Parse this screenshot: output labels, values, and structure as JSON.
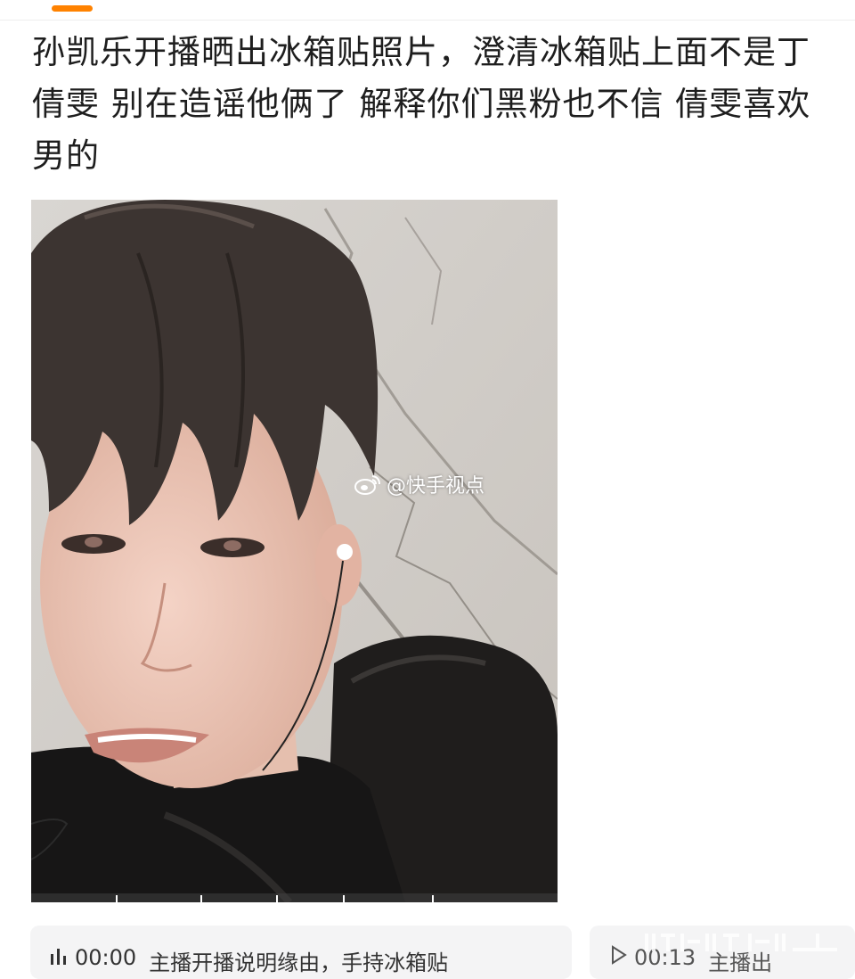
{
  "nav": {
    "active_tab_color": "#ff8200"
  },
  "post": {
    "text": "孙凯乐开播晒出冰箱贴照片，澄清冰箱贴上面不是丁倩雯 别在造谣他俩了 解释你们黑粉也不信 倩雯喜欢男的"
  },
  "media": {
    "watermark": "@快手视点",
    "watermark_icon": "weibo-logo-icon"
  },
  "video_chips": [
    {
      "icon": "audio-wave-icon",
      "time": "00:00",
      "title": "主播开播说明缘由，手持冰箱贴"
    },
    {
      "icon": "play-icon",
      "time": "00:13",
      "title": "主播出"
    }
  ]
}
